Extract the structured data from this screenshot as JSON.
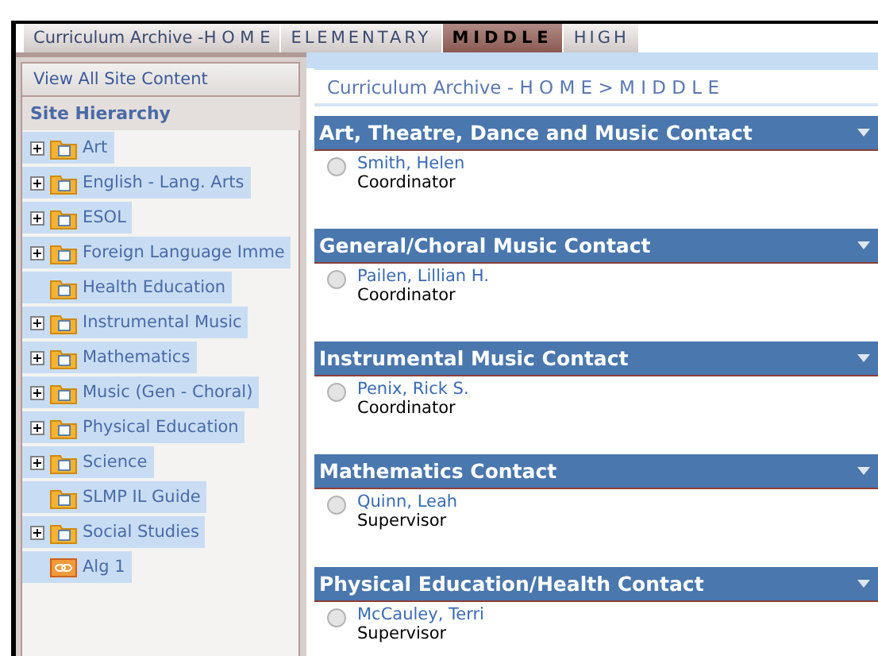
{
  "tabs": [
    {
      "label": "Curriculum Archive -H O M E",
      "selected": false
    },
    {
      "label": "ELEMENTARY",
      "selected": false
    },
    {
      "label": "MIDDLE",
      "selected": true
    },
    {
      "label": "HIGH",
      "selected": false
    }
  ],
  "sidebar": {
    "view_all": "View All Site Content",
    "heading": "Site Hierarchy",
    "items": [
      {
        "label": "Art",
        "expandable": true,
        "kind": "folder"
      },
      {
        "label": "English - Lang. Arts",
        "expandable": true,
        "kind": "folder"
      },
      {
        "label": "ESOL",
        "expandable": true,
        "kind": "folder"
      },
      {
        "label": "Foreign Language Imme",
        "expandable": true,
        "kind": "folder"
      },
      {
        "label": "Health Education",
        "expandable": false,
        "kind": "folder"
      },
      {
        "label": "Instrumental Music",
        "expandable": true,
        "kind": "folder"
      },
      {
        "label": "Mathematics",
        "expandable": true,
        "kind": "folder"
      },
      {
        "label": "Music (Gen - Choral)",
        "expandable": true,
        "kind": "folder"
      },
      {
        "label": "Physical Education",
        "expandable": true,
        "kind": "folder"
      },
      {
        "label": "Science",
        "expandable": true,
        "kind": "folder"
      },
      {
        "label": "SLMP IL Guide",
        "expandable": false,
        "kind": "folder"
      },
      {
        "label": "Social Studies",
        "expandable": true,
        "kind": "folder"
      },
      {
        "label": "Alg 1",
        "expandable": false,
        "kind": "link"
      }
    ]
  },
  "breadcrumb": "Curriculum Archive - H O M E > M I D D L E",
  "sections": [
    {
      "title": "Art, Theatre, Dance and Music Contact",
      "name": "Smith, Helen",
      "role": "Coordinator"
    },
    {
      "title": "General/Choral Music Contact",
      "name": "Pailen, Lillian H.",
      "role": "Coordinator"
    },
    {
      "title": "Instrumental Music Contact",
      "name": "Penix, Rick S.",
      "role": "Coordinator"
    },
    {
      "title": "Mathematics Contact",
      "name": "Quinn, Leah",
      "role": "Supervisor"
    },
    {
      "title": "Physical Education/Health Contact",
      "name": "McCauley, Terri",
      "role": "Supervisor"
    }
  ]
}
